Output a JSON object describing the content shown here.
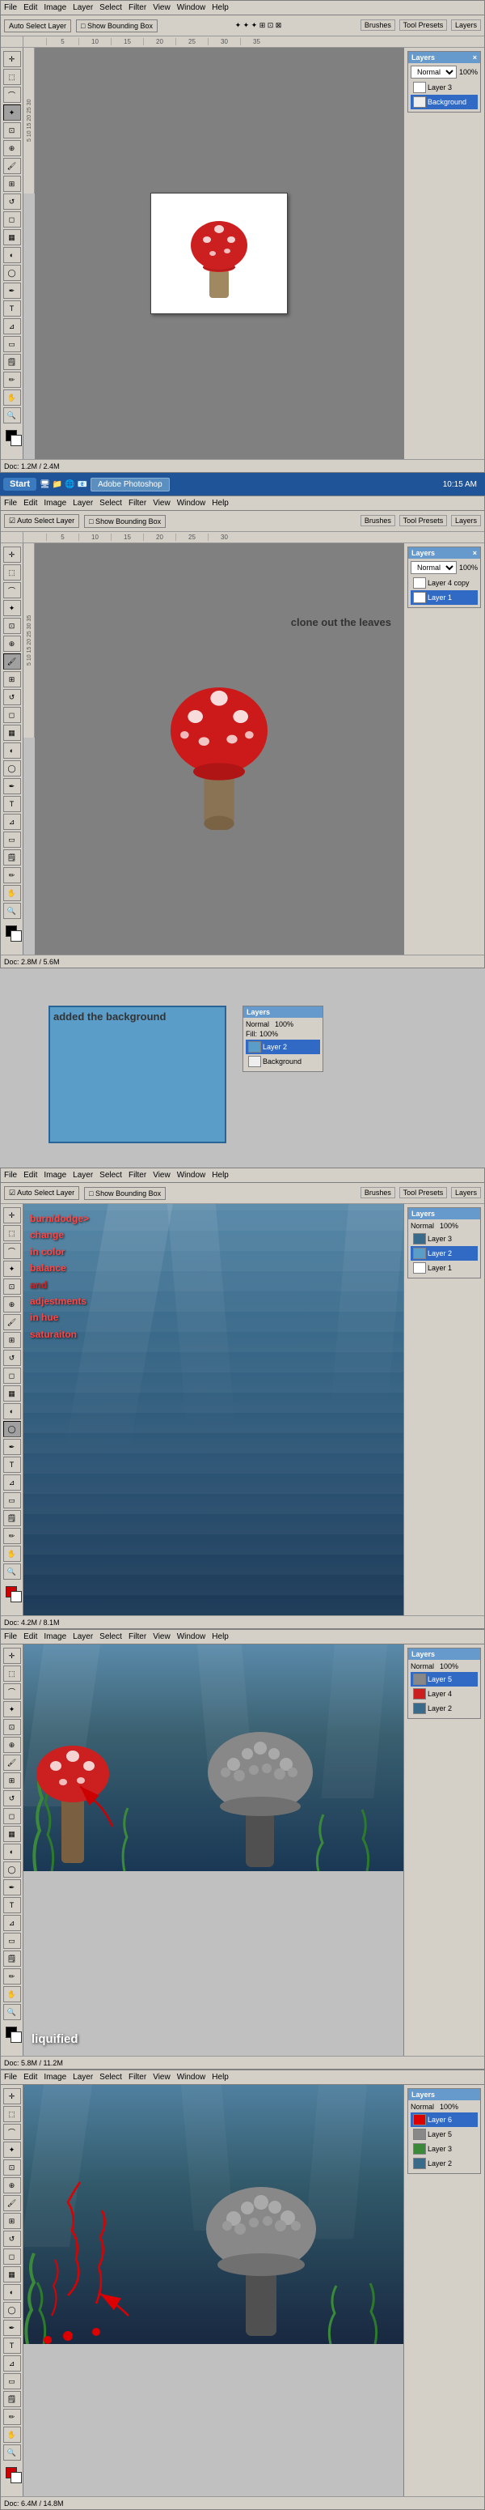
{
  "app": {
    "title": "Adobe Photoshop",
    "taskbar_start": "Start",
    "taskbar_items": [
      "Adobe Photoshop"
    ],
    "clock": "10:15 AM"
  },
  "menus": {
    "file": "File",
    "edit": "Edit",
    "image": "Image",
    "layer": "Layer",
    "select": "Select",
    "filter": "Filter",
    "view": "View",
    "window": "Window",
    "help": "Help"
  },
  "sections": [
    {
      "id": "s1",
      "description": "Photoshop window with mushroom on white canvas",
      "canvas_size": "160x140",
      "panels": {
        "layers_title": "Layers",
        "mode": "Normal",
        "opacity": "100%",
        "layers": [
          {
            "name": "Layer 3",
            "selected": false
          },
          {
            "name": "Background",
            "selected": true
          }
        ]
      }
    },
    {
      "id": "s2",
      "description": "Second Photoshop window - larger mushroom view",
      "annotation": "clone out the leaves",
      "panels": {
        "layers_title": "Layers",
        "mode": "Normal",
        "opacity": "100%",
        "layers": [
          {
            "name": "Layer 4 copy",
            "selected": false
          },
          {
            "name": "Layer 1",
            "selected": true
          }
        ]
      }
    },
    {
      "id": "s3",
      "description": "Blue background added",
      "annotation": "added the background"
    },
    {
      "id": "s4",
      "description": "Burn dodge adjustments",
      "annotation": "burn/dodge>\nchange\nin color\nbalance\nand\nadjestments\nin hue\nsaturaiton"
    },
    {
      "id": "s5",
      "description": "Liquified mushroom scene",
      "annotation": "liquified"
    },
    {
      "id": "s6",
      "description": "Final scene with arrows and red lines"
    }
  ]
}
